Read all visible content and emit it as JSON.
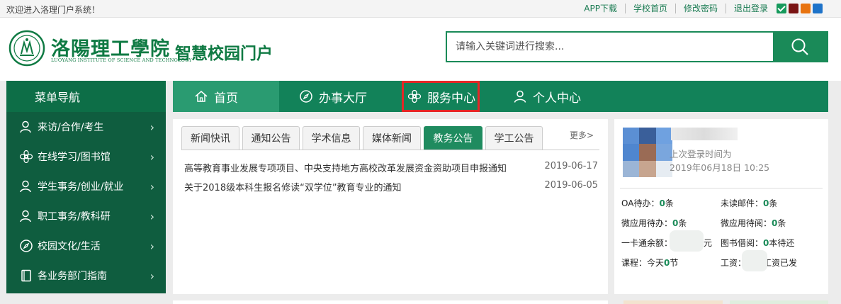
{
  "topbar": {
    "welcome": "欢迎进入洛理门户系统！",
    "links": [
      "APP下载",
      "学校首页",
      "修改密码",
      "退出登录"
    ],
    "theme_colors": [
      "#169a5c",
      "#7a1414",
      "#e8730f",
      "#1e73c9"
    ]
  },
  "header": {
    "logo_cn": "洛陽理工學院",
    "logo_en": "LUOYANG INSTITUTE OF SCIENCE AND TECHNOLOGY",
    "portal_title": "智慧校园门户",
    "search_placeholder": "请输入关键词进行搜索..."
  },
  "nav": {
    "menu_title": "菜单导航",
    "items": [
      {
        "label": "首页",
        "icon": "home-icon"
      },
      {
        "label": "办事大厅",
        "icon": "compass-icon"
      },
      {
        "label": "服务中心",
        "icon": "flower-icon"
      },
      {
        "label": "个人中心",
        "icon": "person-icon"
      }
    ]
  },
  "sidebar": {
    "items": [
      {
        "label": "来访/合作/考生",
        "icon": "user-icon"
      },
      {
        "label": "在线学习/图书馆",
        "icon": "flower-icon"
      },
      {
        "label": "学生事务/创业/就业",
        "icon": "user-icon"
      },
      {
        "label": "职工事务/教科研",
        "icon": "user-icon"
      },
      {
        "label": "校园文化/生活",
        "icon": "compass-icon"
      },
      {
        "label": "各业务部门指南",
        "icon": "book-icon"
      }
    ]
  },
  "news": {
    "tabs": [
      "新闻快讯",
      "通知公告",
      "学术信息",
      "媒体新闻",
      "教务公告",
      "学工公告"
    ],
    "active_tab": "教务公告",
    "more": "更多>",
    "items": [
      {
        "title": "高等教育事业发展专项项目、中央支持地方高校改革发展资金资助项目申报通知",
        "date": "2019-06-17"
      },
      {
        "title": "关于2018级本科生报名修读“双学位”教育专业的通知",
        "date": "2019-06-05"
      }
    ]
  },
  "user": {
    "last_login_label": "上次登录时间为",
    "last_login_time": "2019年06月18日 10:25",
    "stats": {
      "oa_label": "OA待办：",
      "oa_value": "0",
      "oa_unit": "条",
      "mail_label": "未读邮件：",
      "mail_value": "0",
      "mail_unit": "条",
      "micro_todo_label": "微应用待办：",
      "micro_todo_value": "0",
      "micro_todo_unit": "条",
      "micro_read_label": "微应用待阅：",
      "micro_read_value": "0",
      "micro_read_unit": "条",
      "card_label": "一卡通余额：",
      "card_suffix": "元",
      "lib_label": "图书借阅：",
      "lib_value": "0",
      "lib_unit": "本待还",
      "course_label": "课程：今天",
      "course_value": "0",
      "course_unit": "节",
      "salary_label": "工资：",
      "salary_suffix": "工资已发"
    }
  }
}
